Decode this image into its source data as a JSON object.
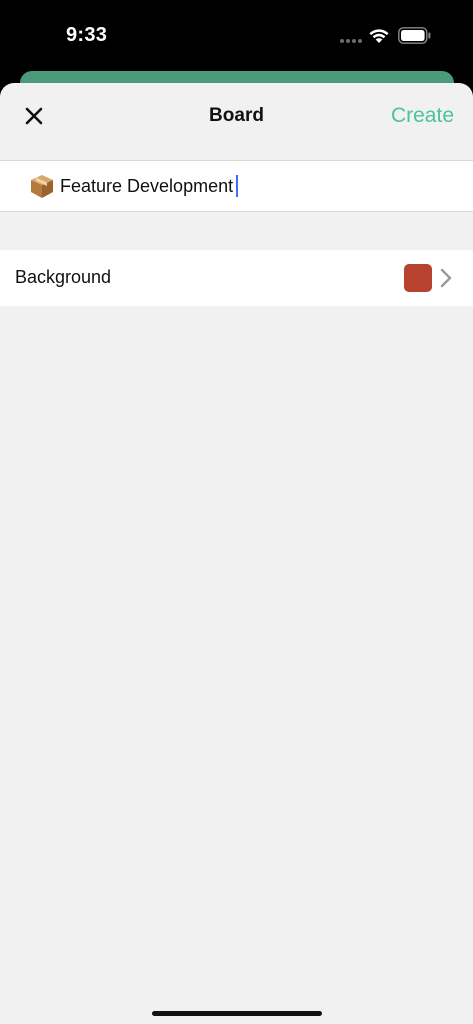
{
  "status_bar": {
    "time": "9:33"
  },
  "nav": {
    "title": "Board",
    "create_label": "Create"
  },
  "board": {
    "emoji": "package-icon",
    "name": "Feature Development"
  },
  "background_setting": {
    "label": "Background",
    "color": "#b7432f"
  },
  "colors": {
    "accent": "#4cc398",
    "back_card": "#4c9a7c",
    "caret": "#3d6bff"
  }
}
